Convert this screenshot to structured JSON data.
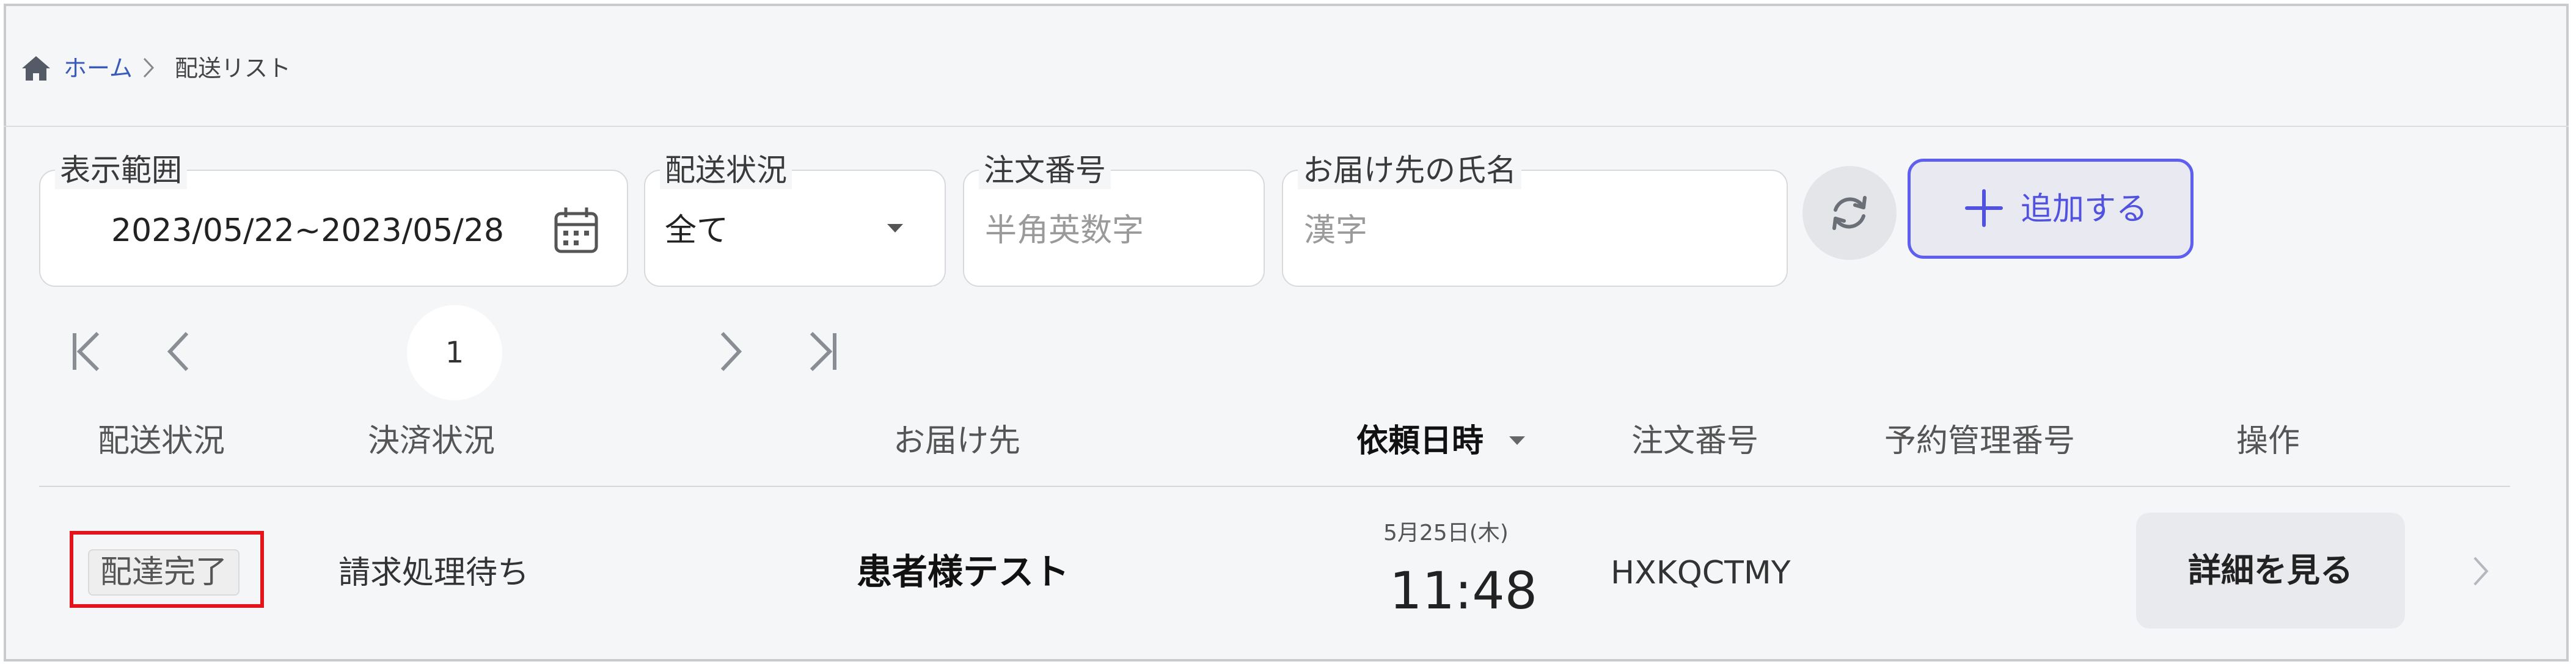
{
  "breadcrumb": {
    "home": "ホーム",
    "current": "配送リスト"
  },
  "filters": {
    "range": {
      "label": "表示範囲",
      "value": "2023/05/22~2023/05/28"
    },
    "status": {
      "label": "配送状況",
      "value": "全て"
    },
    "order_no": {
      "label": "注文番号",
      "placeholder": "半角英数字"
    },
    "recipient": {
      "label": "お届け先の氏名",
      "placeholder": "漢字"
    }
  },
  "actions": {
    "add_label": "追加する"
  },
  "pagination": {
    "current_page": "1"
  },
  "table": {
    "headers": {
      "delivery_status": "配送状況",
      "payment_status": "決済状況",
      "recipient": "お届け先",
      "request_datetime": "依頼日時",
      "order_no": "注文番号",
      "reservation_no": "予約管理番号",
      "operation": "操作"
    },
    "rows": [
      {
        "delivery_status": "配達完了",
        "payment_status": "請求処理待ち",
        "recipient": "患者様テスト",
        "date": "5月25日(木)",
        "time": "11:48",
        "order_no": "HXKQCTMY",
        "reservation_no": "",
        "action_label": "詳細を見る"
      }
    ]
  },
  "colors": {
    "accent": "#5e5ef0",
    "link": "#3a5bb8",
    "highlight": "#e3151a",
    "background": "#f5f6f8"
  },
  "icons": {
    "home": "home-icon",
    "breadcrumb_separator": "chevron-right-icon",
    "calendar": "calendar-icon",
    "dropdown": "caret-down-icon",
    "refresh": "refresh-icon",
    "add": "plus-icon",
    "first_page": "first-page-icon",
    "prev_page": "chevron-left-icon",
    "next_page": "chevron-right-icon",
    "last_page": "last-page-icon",
    "sort": "sort-desc-icon",
    "row_open": "chevron-right-icon"
  }
}
